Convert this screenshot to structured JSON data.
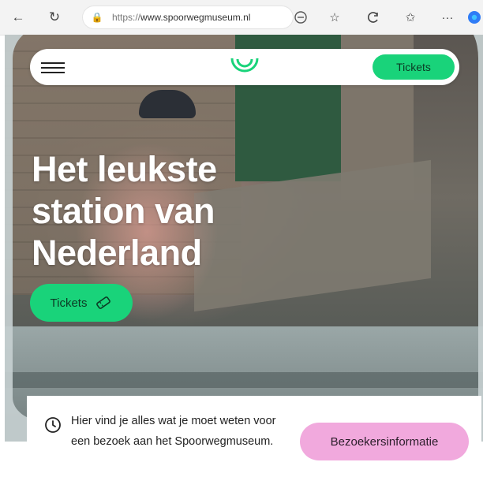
{
  "browser": {
    "url_scheme": "https://",
    "url_host": "www.spoorwegmuseum.nl",
    "icons": [
      "back-icon",
      "refresh-icon",
      "lock-icon",
      "reader-icon",
      "favorite-icon",
      "extensions-icon",
      "collections-icon",
      "more-icon",
      "profile-icon"
    ],
    "more_label": "···"
  },
  "header": {
    "tickets_label": "Tickets"
  },
  "hero": {
    "headline_lines": [
      "Het leukste",
      "station van",
      "Nederland"
    ],
    "tickets_label": "Tickets"
  },
  "info": {
    "text": "Hier vind je alles wat je moet weten voor een bezoek aan het Spoorwegmuseum.",
    "button_label": "Bezoekersinformatie"
  },
  "colors": {
    "accent_green": "#19d37a",
    "pink_button": "#f1a9dd"
  }
}
